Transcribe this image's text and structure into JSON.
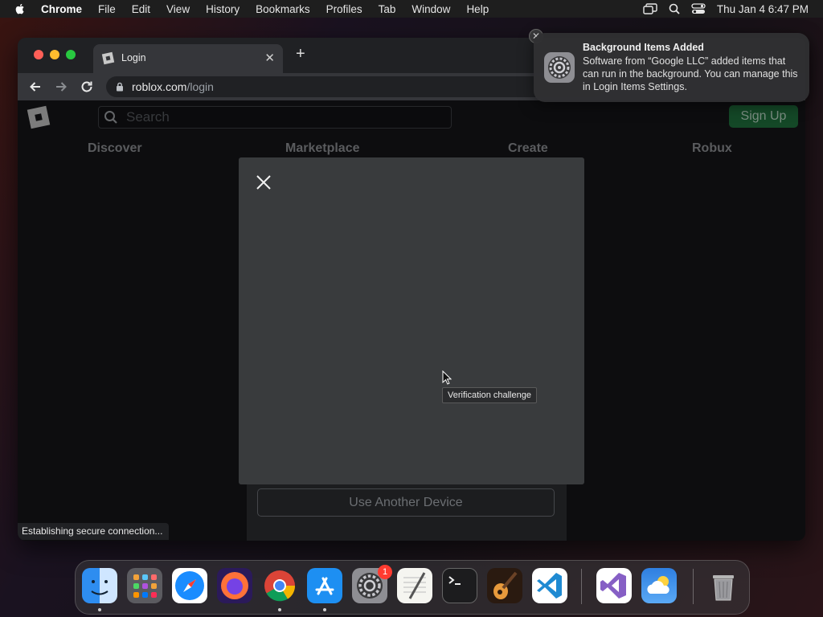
{
  "menubar": {
    "app": "Chrome",
    "items": [
      "File",
      "Edit",
      "View",
      "History",
      "Bookmarks",
      "Profiles",
      "Tab",
      "Window",
      "Help"
    ],
    "clock": "Thu Jan 4  6:47 PM"
  },
  "browser": {
    "tab_title": "Login",
    "url_host": "roblox.com",
    "url_path": "/login",
    "status": "Establishing secure connection..."
  },
  "page": {
    "search_placeholder": "Search",
    "signup": "Sign Up",
    "nav": [
      "Discover",
      "Marketplace",
      "Create",
      "Robux"
    ],
    "tooltip": "Verification challenge",
    "another_device": "Use Another Device"
  },
  "notification": {
    "title": "Background Items Added",
    "body": "Software from “Google LLC” added items that can run in the background. You can manage this in Login Items Settings."
  },
  "dock": {
    "apps": [
      "Finder",
      "Launchpad",
      "Safari",
      "Firefox",
      "Chrome",
      "App Store",
      "System Settings",
      "TextEdit",
      "Terminal",
      "GarageBand",
      "Visual Studio Code",
      "Visual Studio",
      "Weather",
      "Trash"
    ],
    "settings_badge": "1"
  },
  "colors": {
    "accent_green": "#1f6f3c",
    "badge_red": "#ff3b30"
  }
}
